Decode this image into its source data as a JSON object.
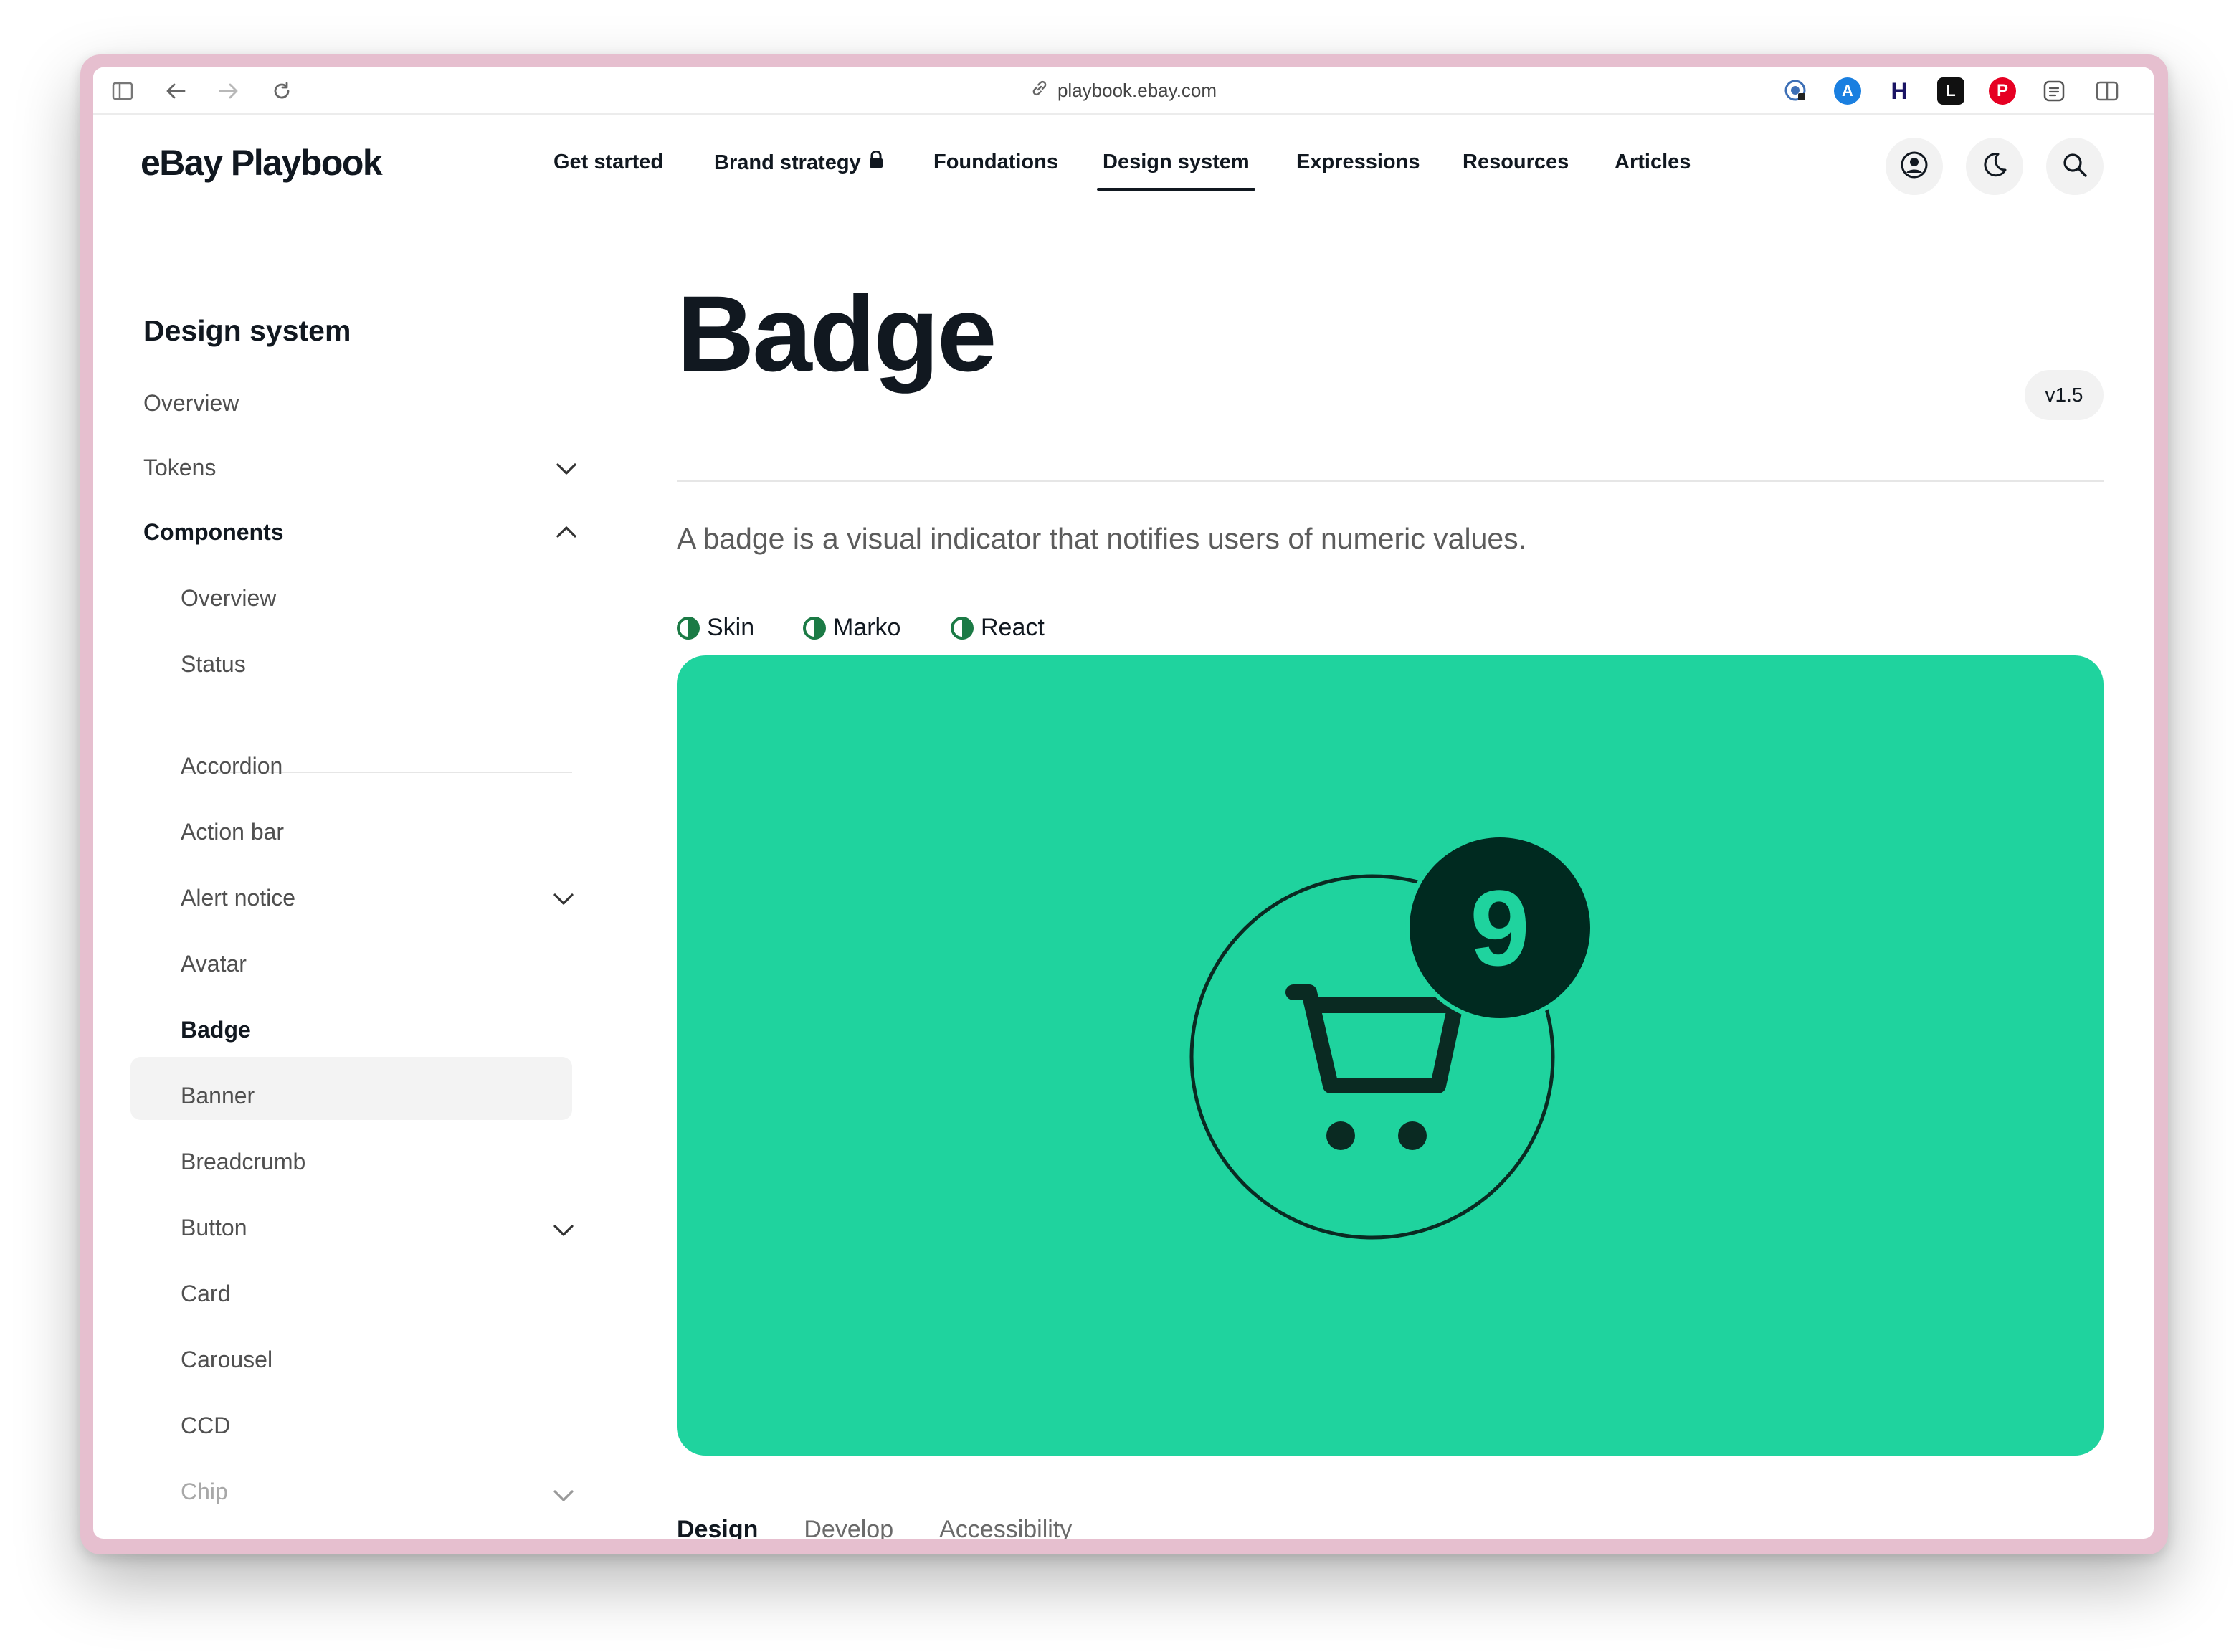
{
  "browser": {
    "url": "playbook.ebay.com",
    "extensions": [
      "password-extension-icon",
      "app-store-icon",
      "h-extension-icon",
      "l-extension-icon",
      "pinterest-icon",
      "layers-extension-icon"
    ]
  },
  "header": {
    "logo": "eBay Playbook",
    "nav": [
      {
        "label": "Get started"
      },
      {
        "label": "Brand strategy"
      },
      {
        "label": "Foundations"
      },
      {
        "label": "Design system",
        "active": true
      },
      {
        "label": "Expressions"
      },
      {
        "label": "Resources"
      },
      {
        "label": "Articles"
      }
    ]
  },
  "sidebar": {
    "title": "Design system",
    "items": [
      {
        "label": "Overview"
      },
      {
        "label": "Tokens",
        "expandable": true
      },
      {
        "label": "Components",
        "expanded": true
      },
      {
        "label": "Overview"
      },
      {
        "label": "Status"
      },
      {
        "label": "Accordion"
      },
      {
        "label": "Action bar"
      },
      {
        "label": "Alert notice",
        "expandable": true
      },
      {
        "label": "Avatar"
      },
      {
        "label": "Badge",
        "selected": true
      },
      {
        "label": "Banner"
      },
      {
        "label": "Breadcrumb"
      },
      {
        "label": "Button",
        "expandable": true
      },
      {
        "label": "Card"
      },
      {
        "label": "Carousel"
      },
      {
        "label": "CCD"
      },
      {
        "label": "Chip",
        "expandable": true
      }
    ]
  },
  "main": {
    "title": "Badge",
    "version": "v1.5",
    "description": "A badge is a visual indicator that notifies users of numeric values.",
    "frameworks": [
      "Skin",
      "Marko",
      "React"
    ],
    "hero": {
      "badge_number": "9",
      "background_color": "#1fd39e",
      "badge_color": "#002a20"
    },
    "tabs": [
      {
        "label": "Design",
        "active": true
      },
      {
        "label": "Develop"
      },
      {
        "label": "Accessibility"
      }
    ]
  },
  "colors": {
    "text": "#111820",
    "status_green": "#1b7a45"
  }
}
